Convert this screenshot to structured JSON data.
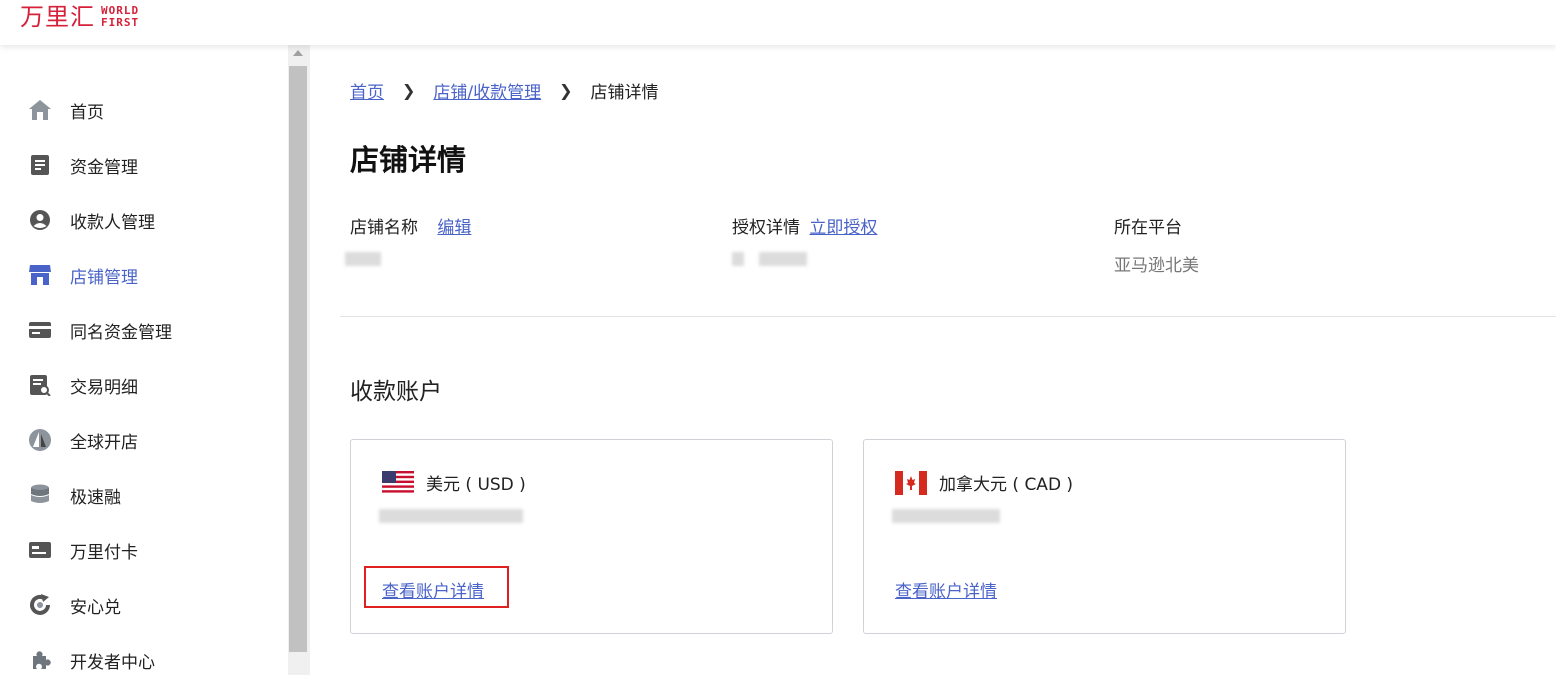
{
  "brand": {
    "name_cn": "万里汇",
    "name_en_line1": "WORLD",
    "name_en_line2": "FIRST",
    "color": "#d6213a"
  },
  "sidebar": {
    "items": [
      {
        "label": "首页",
        "icon": "home-icon"
      },
      {
        "label": "资金管理",
        "icon": "document-icon"
      },
      {
        "label": "收款人管理",
        "icon": "person-icon"
      },
      {
        "label": "店铺管理",
        "icon": "store-icon",
        "active": true
      },
      {
        "label": "同名资金管理",
        "icon": "card-icon"
      },
      {
        "label": "交易明细",
        "icon": "receipt-search-icon"
      },
      {
        "label": "全球开店",
        "icon": "sail-icon"
      },
      {
        "label": "极速融",
        "icon": "coins-icon"
      },
      {
        "label": "万里付卡",
        "icon": "credit-card-icon"
      },
      {
        "label": "安心兑",
        "icon": "exchange-icon"
      },
      {
        "label": "开发者中心",
        "icon": "puzzle-icon"
      }
    ],
    "active_color": "#4a63c9"
  },
  "breadcrumb": {
    "home": "首页",
    "parent": "店铺/收款管理",
    "current": "店铺详情"
  },
  "page": {
    "title": "店铺详情"
  },
  "info": {
    "store_name_label": "店铺名称",
    "edit_link": "编辑",
    "auth_label": "授权详情",
    "auth_link": "立即授权",
    "platform_label": "所在平台",
    "platform_value": "亚马逊北美"
  },
  "accounts": {
    "section_title": "收款账户",
    "cards": [
      {
        "currency": "美元 ( USD )",
        "flag": "us-flag-icon",
        "link": "查看账户详情",
        "highlighted": true
      },
      {
        "currency": "加拿大元 ( CAD )",
        "flag": "ca-flag-icon",
        "link": "查看账户详情",
        "highlighted": false
      }
    ]
  }
}
